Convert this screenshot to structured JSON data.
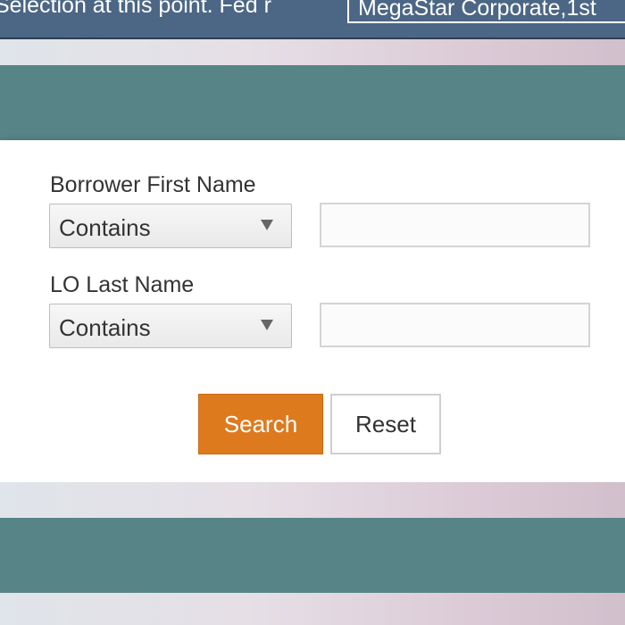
{
  "topbar": {
    "text": "Selection at this point. Fed r",
    "company_select": "MegaStar Corporate,1st"
  },
  "filters": [
    {
      "label": "Borrower First Name",
      "operator": "Contains",
      "value": "",
      "placeholder": ""
    },
    {
      "label": "LO Last Name",
      "operator": "Contains",
      "value": "",
      "placeholder": ""
    }
  ],
  "buttons": {
    "search_label": "Search",
    "reset_label": "Reset"
  },
  "colors": {
    "topbar": "#4c6785",
    "teal_band": "#578487",
    "search_button": "#de7a1e"
  },
  "icons": {
    "dropdown": "triangle-down"
  }
}
